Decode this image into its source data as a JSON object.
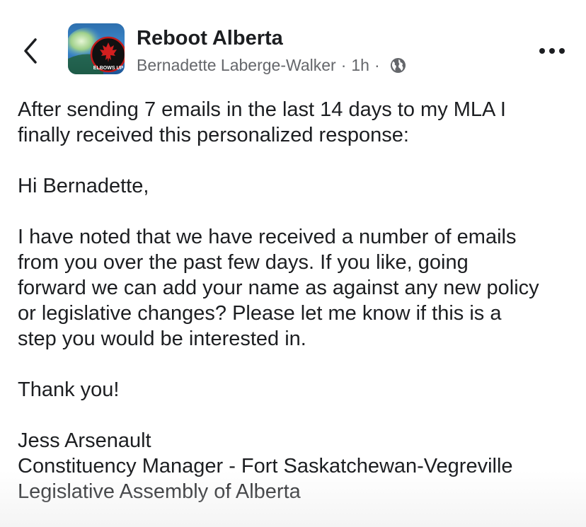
{
  "header": {
    "back_icon": "chevron-left-icon",
    "avatar_text": "ELBOWS UP",
    "group_name": "Reboot Alberta",
    "author": "Bernadette Laberge-Walker",
    "separator": "·",
    "time": "1h",
    "privacy_icon": "globe-icon",
    "more_icon": "more-horizontal-icon"
  },
  "post": {
    "intro": "After sending 7 emails in the last 14 days to my MLA I\nfinally received this personalized response:",
    "greeting": "Hi Bernadette,",
    "body": "I have noted that we have received a number of emails\nfrom you over the past few days. If you like, going\nforward we can add your name as against any new policy\nor legislative changes? Please let me know if this is a\nstep you would be interested in.",
    "thanks": "Thank you!",
    "signature": "Jess Arsenault\nConstituency Manager - Fort Saskatchewan-Vegreville\nLegislative Assembly of Alberta"
  }
}
